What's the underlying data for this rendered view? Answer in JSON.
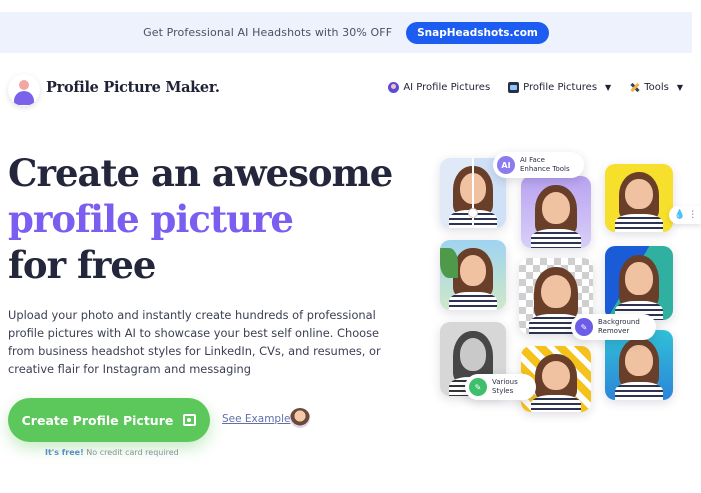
{
  "banner": {
    "text": "Get Professional AI Headshots with 30% OFF",
    "button_label": "SnapHeadshots.com"
  },
  "header": {
    "brand": "Profile Picture Maker.",
    "nav": [
      {
        "label": "AI Profile Pictures",
        "icon": "ai-profile-icon",
        "dropdown": false
      },
      {
        "label": "Profile Pictures",
        "icon": "profile-pictures-icon",
        "dropdown": true
      },
      {
        "label": "Tools",
        "icon": "tools-icon",
        "dropdown": true
      }
    ]
  },
  "hero": {
    "title_line1": "Create an awesome",
    "title_line2": "profile picture",
    "title_line3": "for free",
    "description": "Upload your photo and instantly create hundreds of professional profile pictures with AI to showcase your best self online. Choose from business headshot styles for LinkedIn, CVs, and resumes, or creative flair for Instagram and messaging",
    "cta_label": "Create Profile Picture",
    "see_example": "See Example",
    "free_bold": "It's free!",
    "free_rest": " No credit card required"
  },
  "collage": {
    "badge_ai": "AI",
    "badge_face": "AI Face Enhance Tools",
    "badge_bg": "Background Remover",
    "badge_styles": "Various Styles"
  },
  "colors": {
    "accent_purple": "#7b5df0",
    "cta_green": "#5cc75a",
    "banner_blue": "#1d5cf0"
  }
}
